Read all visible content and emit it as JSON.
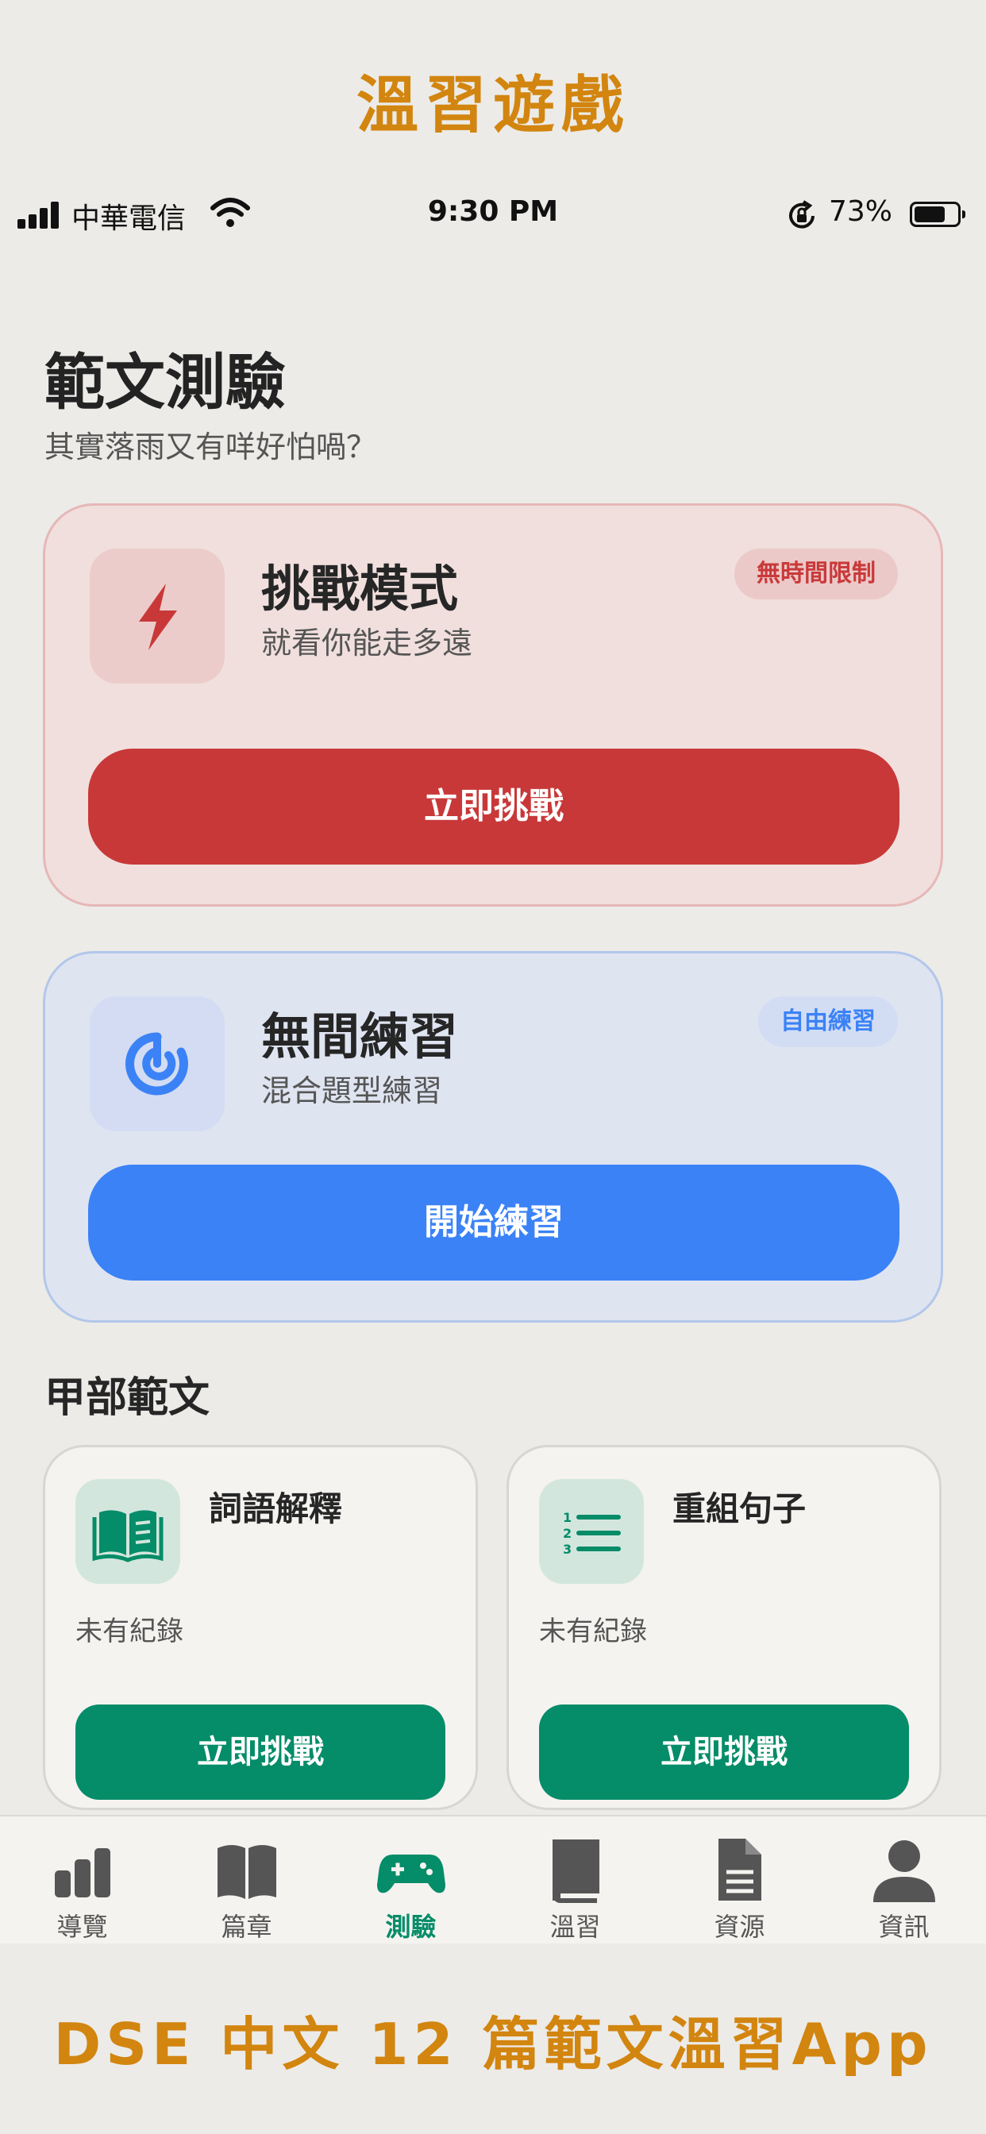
{
  "promo": {
    "top_caption": "溫習遊戲",
    "bottom_caption": "DSE 中文 12 篇範文溫習App"
  },
  "status_bar": {
    "carrier": "中華電信",
    "time": "9:30 PM",
    "battery_percent": "73%",
    "battery_level": 0.73,
    "signal_icon": "signal-bars-icon",
    "wifi_icon": "wifi-icon",
    "orientation_lock_icon": "orientation-lock-icon"
  },
  "header": {
    "title": "範文測驗",
    "subtitle": "其實落雨又有咩好怕喎？"
  },
  "modes": {
    "challenge": {
      "title": "挑戰模式",
      "description": "就看你能走多遠",
      "badge": "無時間限制",
      "button_label": "立即挑戰",
      "icon": "lightning-icon",
      "accent_color": "#c83838"
    },
    "practice": {
      "title": "無間練習",
      "description": "混合題型練習",
      "badge": "自由練習",
      "button_label": "開始練習",
      "icon": "target-icon",
      "accent_color": "#3b82f6"
    }
  },
  "section_a": {
    "title": "甲部範文",
    "cards": [
      {
        "title": "詞語解釋",
        "status": "未有紀錄",
        "button_label": "立即挑戰",
        "icon": "open-book-icon"
      },
      {
        "title": "重組句子",
        "status": "未有紀錄",
        "button_label": "立即挑戰",
        "icon": "numbered-list-icon"
      }
    ],
    "accent_color": "#058c68"
  },
  "tab_bar": {
    "active_index": 2,
    "active_color": "#058c68",
    "items": [
      {
        "label": "導覽",
        "icon": "bar-chart-icon"
      },
      {
        "label": "篇章",
        "icon": "book-open-icon"
      },
      {
        "label": "測驗",
        "icon": "gamepad-icon"
      },
      {
        "label": "溫習",
        "icon": "book-icon"
      },
      {
        "label": "資源",
        "icon": "document-icon"
      },
      {
        "label": "資訊",
        "icon": "person-icon"
      }
    ]
  }
}
